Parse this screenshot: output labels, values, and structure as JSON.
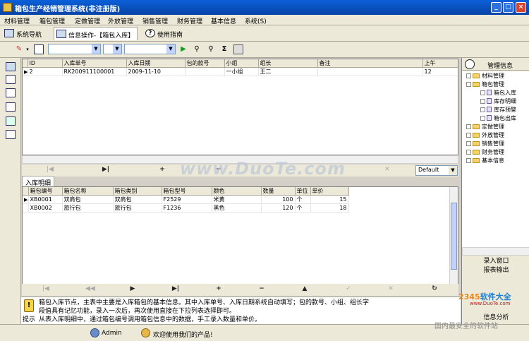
{
  "window": {
    "title": "箱包生产经销管理系统(非注册版)",
    "buttons": [
      "_",
      "□",
      "×"
    ]
  },
  "menu": [
    "材料管理",
    "箱包管理",
    "定做管理",
    "外放管理",
    "销售管理",
    "财务管理",
    "基本信息",
    "系统(S)"
  ],
  "tabs": [
    {
      "label": "系统导航",
      "active": false
    },
    {
      "label": "信息操作-【箱包入库】",
      "active": true
    },
    {
      "label": "使用指南",
      "active": false
    }
  ],
  "toolbar": {
    "icons": [
      "pencil-icon",
      "search-doc-icon",
      "run-icon",
      "find-icon",
      "find-next-icon",
      "sum-icon",
      "print-icon"
    ]
  },
  "main_grid": {
    "headers": [
      "ID",
      "入库单号",
      "入库日期",
      "包的款号",
      "小组",
      "组长",
      "备注",
      "上午"
    ],
    "rows": [
      {
        "id": "2",
        "no": "RK200911100001",
        "date": "2009-11-10",
        "style": "",
        "group": "一小组",
        "leader": "王二",
        "note": "",
        "am": "12"
      }
    ]
  },
  "nav1": {
    "dropdown": "Default"
  },
  "detail": {
    "tab": "入库明细",
    "headers": [
      "箱包编号",
      "箱包名称",
      "箱包类别",
      "箱包型号",
      "颜色",
      "数量",
      "单位",
      "单价"
    ],
    "rows": [
      {
        "code": "XB0001",
        "name": "双肩包",
        "cat": "双肩包",
        "model": "F2529",
        "color": "米黄",
        "qty": "100",
        "unit": "个",
        "price": "15"
      },
      {
        "code": "XB0002",
        "name": "旅行包",
        "cat": "旅行包",
        "model": "F1236",
        "color": "黑色",
        "qty": "120",
        "unit": "个",
        "price": "18"
      }
    ]
  },
  "help": {
    "label": "提示",
    "line1": "箱包入库节点，主表中主要是入库箱包的基本信息。其中入库单号、入库日期系统自动填写；包的款号、小组、组长字",
    "line2": "段值具有记忆功能，录入一次后，再次使用直接在下拉列表选择即可。",
    "line3": "从表入库明细中，通过箱包编号调用箱包信息中的数据，手工录入数量和单价。"
  },
  "right_panel": {
    "title": "管理信息",
    "tree": [
      {
        "label": "材料管理",
        "level": 0,
        "type": "folder",
        "expanded": false
      },
      {
        "label": "箱包管理",
        "level": 0,
        "type": "folder",
        "expanded": true
      },
      {
        "label": "箱包入库",
        "level": 1,
        "type": "doc"
      },
      {
        "label": "库存明细",
        "level": 1,
        "type": "doc"
      },
      {
        "label": "库存预警",
        "level": 1,
        "type": "doc"
      },
      {
        "label": "箱包出库",
        "level": 1,
        "type": "doc"
      },
      {
        "label": "定做管理",
        "level": 0,
        "type": "folder",
        "expanded": false
      },
      {
        "label": "外放管理",
        "level": 0,
        "type": "folder",
        "expanded": false
      },
      {
        "label": "销售管理",
        "level": 0,
        "type": "folder",
        "expanded": false
      },
      {
        "label": "财务管理",
        "level": 0,
        "type": "folder",
        "expanded": false
      },
      {
        "label": "基本信息",
        "level": 0,
        "type": "folder",
        "expanded": false
      }
    ],
    "buttons": [
      "录入窗口",
      "报表输出",
      "信息分析"
    ]
  },
  "status": {
    "user": "Admin",
    "message": "欢迎使用我们的产品!"
  },
  "watermarks": {
    "center": "www.DuoTe.com",
    "brand_a": "2345",
    "brand_b": "软件大全",
    "brand_url": "www.DuoTe.com",
    "corner": "国内最安全的软件站"
  },
  "colors": {
    "titlebar": "#0a5fd8",
    "selection": "#c1d3fb",
    "chrome": "#ece9d8"
  }
}
